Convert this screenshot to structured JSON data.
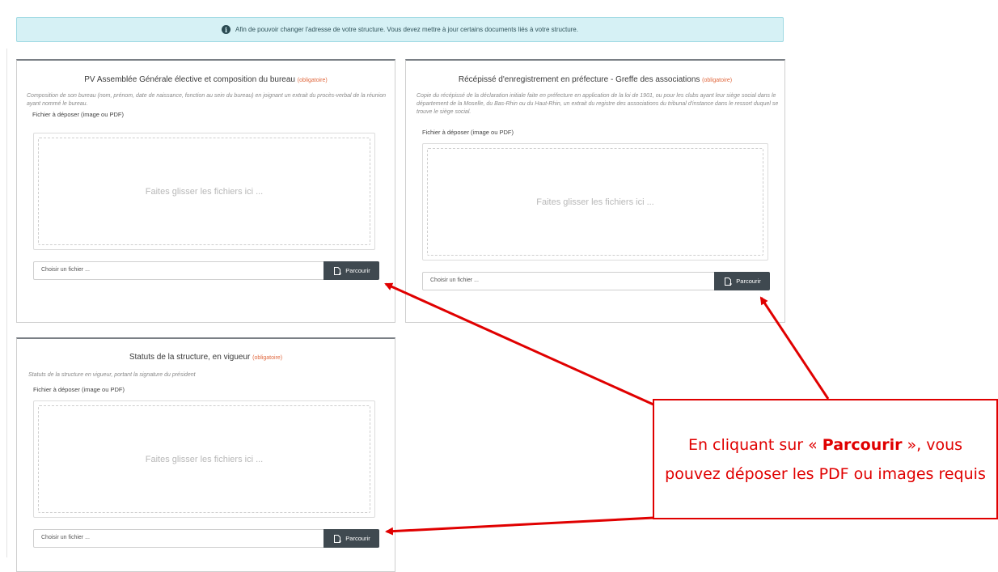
{
  "alert": {
    "text": "Afin de pouvoir changer l'adresse de votre structure. Vous devez mettre à jour certains documents liés à votre structure.",
    "icon": "info-circle-icon"
  },
  "cards": [
    {
      "title": "PV Assemblée Générale élective et composition du bureau",
      "required": "(obligatoire)",
      "description": "Composition de son bureau (nom, prénom, date de naissance, fonction au sein du bureau) en joignant un extrait du procès-verbal de la réunion ayant nommé le bureau.",
      "file_label": "Fichier à déposer (image ou PDF)",
      "drop_text": "Faites glisser les fichiers ici ...",
      "file_placeholder": "Choisir un fichier ...",
      "browse_label": "Parcourir"
    },
    {
      "title": "Récépissé d'enregistrement en préfecture - Greffe des associations",
      "required": "(obligatoire)",
      "description": "Copie du récépissé de la déclaration initiale faite en préfecture en application de la loi de 1901, ou pour les clubs ayant leur siège social dans le département de la Moselle, du Bas-Rhin ou du Haut-Rhin, un extrait du registre des associations du tribunal d'instance dans le ressort duquel se trouve le siège social.",
      "file_label": "Fichier à déposer (image ou PDF)",
      "drop_text": "Faites glisser les fichiers ici ...",
      "file_placeholder": "Choisir un fichier ...",
      "browse_label": "Parcourir"
    },
    {
      "title": "Statuts de la structure, en vigueur",
      "required": "(obligatoire)",
      "description": "Statuts de la structure en vigueur, portant la signature du président",
      "file_label": "Fichier à déposer (image ou PDF)",
      "drop_text": "Faites glisser les fichiers ici ...",
      "file_placeholder": "Choisir un fichier ...",
      "browse_label": "Parcourir"
    }
  ],
  "callout": {
    "prefix": "En cliquant sur « ",
    "bold": "Parcourir",
    "suffix": " », vous pouvez déposer les PDF ou images requis"
  },
  "colors": {
    "alert_bg": "#d6f1f5",
    "required": "#e0683e",
    "button": "#3f4950",
    "annotation": "#e00000"
  }
}
